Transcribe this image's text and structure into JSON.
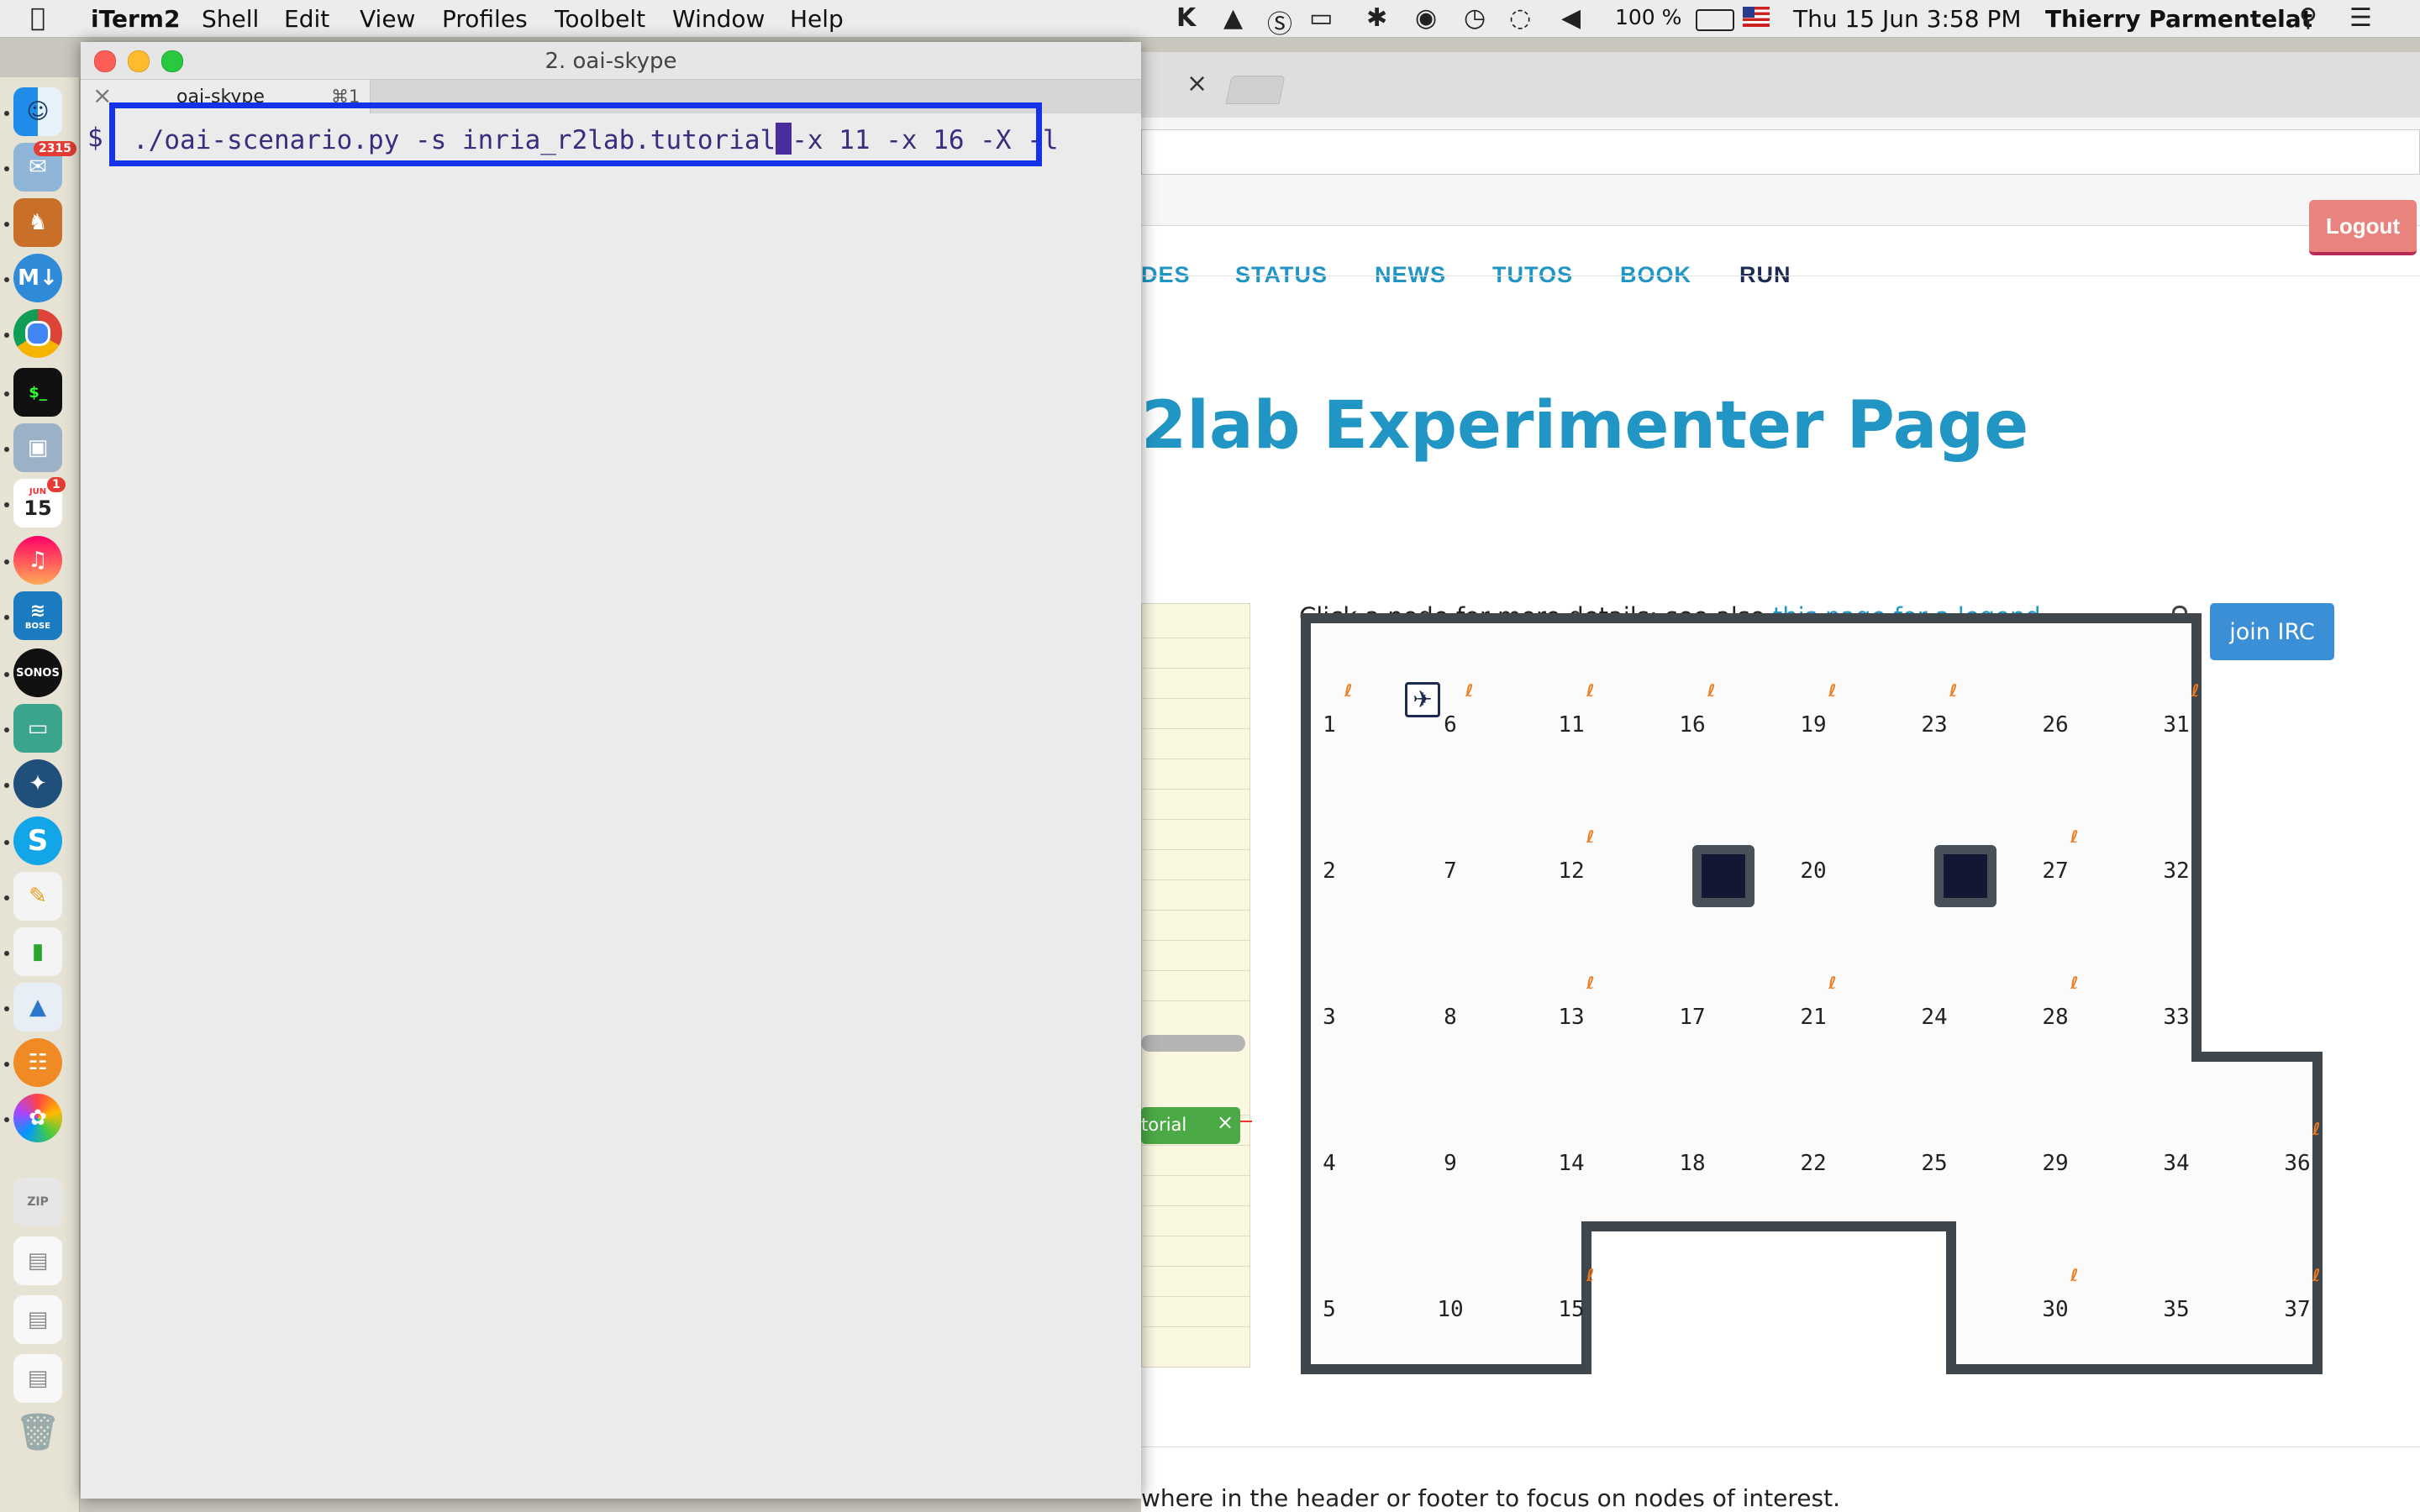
{
  "menubar": {
    "app": "iTerm2",
    "menus": [
      "Shell",
      "Edit",
      "View",
      "Profiles",
      "Toolbelt",
      "Window",
      "Help"
    ],
    "battery": "100 %",
    "datetime": "Thu 15 Jun  3:58 PM",
    "user": "Thierry Parmentelat"
  },
  "dock": {
    "mail_badge": "2315",
    "calendar_badge": "1",
    "calendar_month": "JUN",
    "calendar_day": "15",
    "sonos_label": "SONOS",
    "bose_label": "BOSE"
  },
  "iterm": {
    "title": "2. oai-skype",
    "tab_label": "oai-skype",
    "tab_shortcut": "⌘1",
    "prompt": "$",
    "command_before": "./oai-scenario.py -s inria_r2lab.tutorial",
    "command_after": "-x 11 -x 16 -X -l"
  },
  "browser": {
    "nav": [
      "DES",
      "STATUS",
      "NEWS",
      "TUTOS",
      "BOOK",
      "RUN"
    ],
    "logout_label": "Logout",
    "heading": "2lab Experimenter Page",
    "hint_text": "Click a node for more details; see also ",
    "hint_link": "this page for a legend",
    "irc_label": "join IRC",
    "tutorial_pill": "torial",
    "footer_text": "where in the header or footer to focus on nodes of interest."
  },
  "nodemap": {
    "nodes": [
      "1",
      "2",
      "3",
      "4",
      "5",
      "6",
      "7",
      "8",
      "9",
      "10",
      "11",
      "12",
      "13",
      "14",
      "15",
      "16",
      "17",
      "18",
      "19",
      "20",
      "21",
      "22",
      "23",
      "24",
      "25",
      "26",
      "27",
      "28",
      "29",
      "30",
      "31",
      "32",
      "33",
      "34",
      "35",
      "36",
      "37"
    ],
    "colors": {
      "wall": "#3f464c",
      "wifi": "#ef7b1e"
    }
  }
}
